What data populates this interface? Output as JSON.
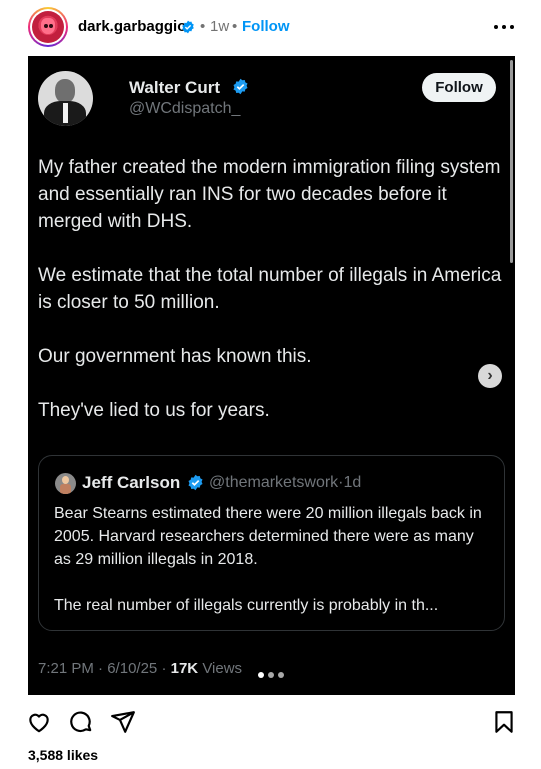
{
  "header": {
    "username": "dark.garbaggio",
    "separator": "•",
    "time_ago": "1w",
    "follow_label": "Follow",
    "avatar_icon": "profile-avatar",
    "more_icon": "more-horizontal-icon"
  },
  "tweet": {
    "name": "Walter Curt",
    "handle": "@WCdispatch_",
    "follow_label": "Follow",
    "paragraphs": [
      "My father created the modern immigration filing system and essentially ran INS for two decades before it merged with DHS.",
      "We estimate that the total number of illegals in America is closer to 50 million.",
      "Our government has known this.",
      "They've lied to us for years."
    ],
    "quote": {
      "name": "Jeff Carlson",
      "handle": "@themarketswork",
      "separator": "·",
      "age": "1d",
      "paragraphs": [
        "Bear Stearns estimated there were 20 million illegals back in 2005. Harvard researchers determined there were as many as 29 million illegals in 2018.",
        "The real number of illegals currently is probably in th..."
      ]
    },
    "time": "7:21 PM",
    "date": "6/10/25",
    "views_count": "17K",
    "views_label": "Views",
    "meta_sep": "·",
    "verified_color": "#1d9bf0",
    "background_color": "#000000"
  },
  "carousel": {
    "total": 3,
    "active_index": 0
  },
  "actions": {
    "icons": [
      "heart-icon",
      "comment-icon",
      "share-icon",
      "bookmark-icon"
    ],
    "likes_text": "3,588 likes"
  },
  "colors": {
    "link_blue": "#0095f6",
    "muted": "#737373"
  }
}
